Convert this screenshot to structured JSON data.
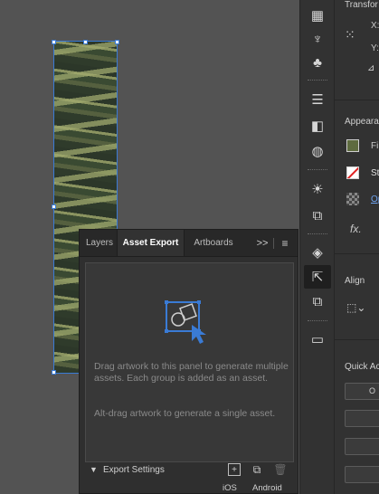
{
  "panel": {
    "tabs": [
      {
        "label": "Layers"
      },
      {
        "label": "Asset Export"
      },
      {
        "label": "Artboards"
      }
    ],
    "overflow_label": ">>",
    "message1": "Drag artwork to this panel to generate multiple assets. Each group is added as an asset.",
    "message2": "Alt-drag artwork to generate a single asset.",
    "export_settings_label": "Export Settings",
    "ios_label": "iOS",
    "android_label": "Android"
  },
  "properties": {
    "transform_title": "Transfor",
    "x_label": "X:",
    "y_label": "Y:",
    "appearance_title": "Appearanc",
    "fill_label": "Fi",
    "stroke_label": "St",
    "opacity_label": "Op",
    "fx_label": "fx.",
    "align_title": "Align",
    "quick_actions_title": "Quick Ac",
    "quick_btn_label": "O"
  },
  "colors": {
    "accent": "#3a7bd5",
    "panel_bg": "#2f2f2f",
    "canvas_bg": "#535353"
  }
}
